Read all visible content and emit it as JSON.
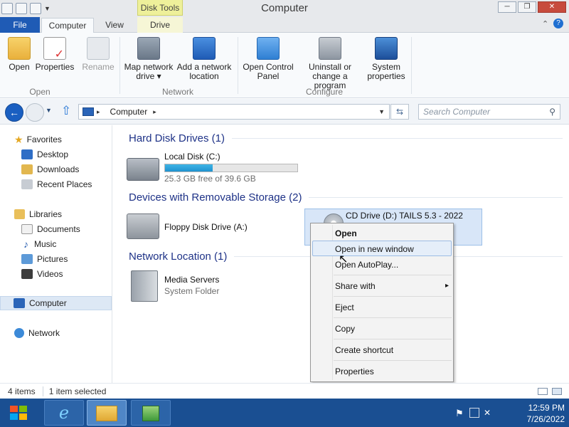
{
  "window": {
    "title": "Computer",
    "contextual_tab_group": "Disk Tools",
    "controls": {
      "minimize": "─",
      "restore": "❐",
      "close": "✕"
    }
  },
  "ribbon": {
    "tabs": [
      "File",
      "Computer",
      "View",
      "Drive"
    ],
    "active_tab": "Computer",
    "groups": [
      {
        "name": "Open",
        "buttons": [
          "Open",
          "Properties",
          "Rename"
        ]
      },
      {
        "name": "Network",
        "buttons": [
          "Map network drive ▾",
          "Add a network location"
        ]
      },
      {
        "name": "Configure",
        "buttons": [
          "Open Control Panel",
          "Uninstall or change a program",
          "System properties"
        ]
      }
    ]
  },
  "address": {
    "path": [
      "Computer"
    ],
    "search_placeholder": "Search Computer"
  },
  "nav_pane": {
    "favorites": {
      "label": "Favorites",
      "items": [
        "Desktop",
        "Downloads",
        "Recent Places"
      ]
    },
    "libraries": {
      "label": "Libraries",
      "items": [
        "Documents",
        "Music",
        "Pictures",
        "Videos"
      ]
    },
    "computer": "Computer",
    "network": "Network"
  },
  "content": {
    "groups": [
      {
        "heading": "Hard Disk Drives (1)"
      },
      {
        "heading": "Devices with Removable Storage (2)"
      },
      {
        "heading": "Network Location (1)"
      }
    ],
    "drives": {
      "local_disk": {
        "name": "Local Disk (C:)",
        "free": "25.3 GB free of 39.6 GB",
        "used_fraction": 0.361
      },
      "floppy": {
        "name": "Floppy Disk Drive (A:)"
      },
      "cd": {
        "name": "CD Drive (D:) TAILS 5.3 - 2022"
      },
      "media": {
        "name": "Media Servers",
        "sub": "System Folder"
      }
    }
  },
  "context_menu": {
    "items": [
      "Open",
      "Open in new window",
      "Open AutoPlay...",
      "Share with",
      "Eject",
      "Copy",
      "Create shortcut",
      "Properties"
    ],
    "submenu_arrow": "▸"
  },
  "status": {
    "count": "4 items",
    "selection": "1 item selected"
  },
  "taskbar": {
    "time": "12:59 PM",
    "date": "7/26/2022"
  },
  "colors": {
    "accent": "#1f5bb5",
    "taskbar": "#1a4f92",
    "group_heading": "#1e3287",
    "disk_bar": "#26a0da"
  }
}
